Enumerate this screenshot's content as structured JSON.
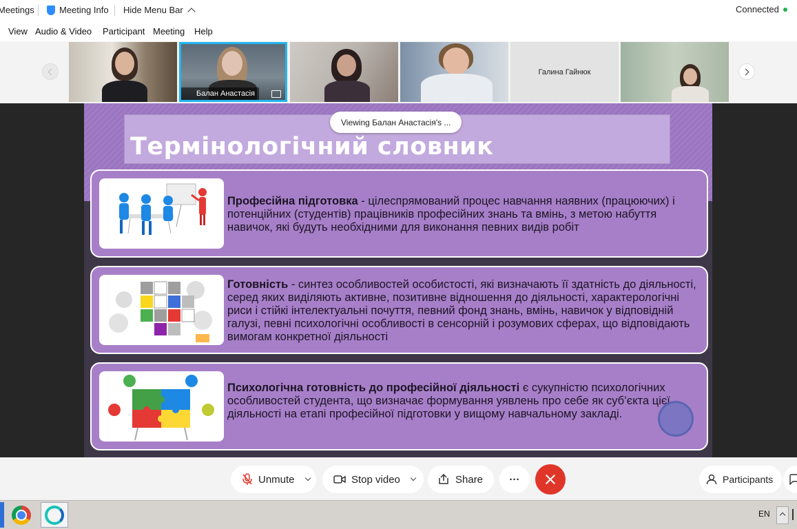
{
  "topbar": {
    "meetings": "Meetings",
    "meeting_info": "Meeting Info",
    "hide_menu_bar": "Hide Menu Bar",
    "status": "Connected"
  },
  "menu": {
    "view": "View",
    "audio_video": "Audio & Video",
    "participant": "Participant",
    "meeting": "Meeting",
    "help": "Help"
  },
  "thumbnails": [
    {
      "name": ""
    },
    {
      "name": "Балан Анастасія"
    },
    {
      "name": ""
    },
    {
      "name": ""
    },
    {
      "name": "Галина Гайнюк"
    },
    {
      "name": ""
    }
  ],
  "viewing_label": "Viewing Балан Анастасія's ...",
  "slide": {
    "title": "Термінологічний словник",
    "cards": [
      {
        "term": "Професійна підготовка",
        "definition": " - цілеспрямований процес навчання наявних (працюючих) і потенційних (студентів) працівників професійних знань та вмінь, з метою набуття навичок, які будуть необхідними для виконання певних видів робіт"
      },
      {
        "term": "Готовність",
        "definition": " - синтез особливостей особистості, які визначають її здатність до діяльності, серед яких виділяють активне, позитивне відношення до діяльності, характерологічні риси і стійкі інтелектуальні почуття, певний фонд знань, вмінь, навичок у відповідній галузі, певні психологічні особливості в сенсорній і розумових сферах, що відповідають вимогам конкретної діяльності"
      },
      {
        "term": "Психологічна готовність до професійної діяльності",
        "definition": " є сукупністю психологічних особливостей студента, що визначає формування уявлень про себе як суб’єкта цієї діяльності на етапі професійної підготовки у вищому навчальному закладі."
      }
    ]
  },
  "controls": {
    "unmute": "Unmute",
    "stop_video": "Stop video",
    "share": "Share",
    "more": "···",
    "participants": "Participants"
  },
  "taskbar": {
    "language": "EN"
  }
}
